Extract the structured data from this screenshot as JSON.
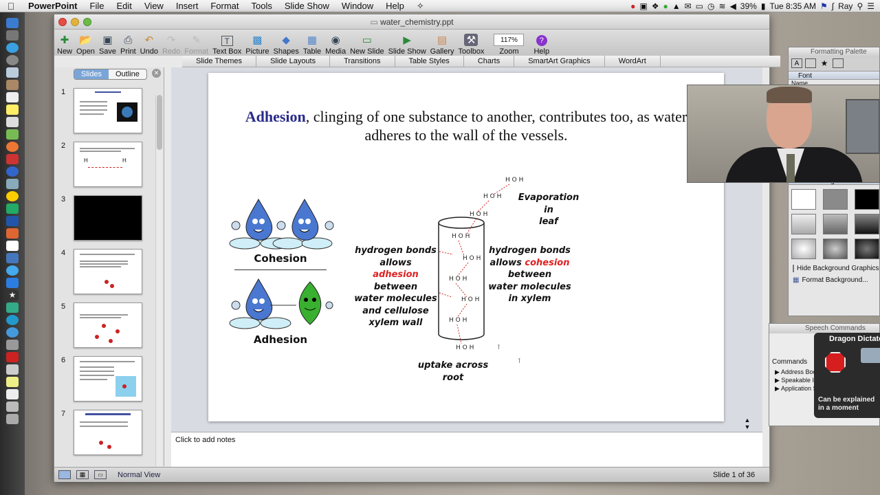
{
  "menubar": {
    "app": "PowerPoint",
    "items": [
      "File",
      "Edit",
      "View",
      "Insert",
      "Format",
      "Tools",
      "Slide Show",
      "Window",
      "Help"
    ],
    "battery": "39%",
    "clock": "Tue 8:35 AM",
    "user": "Ray"
  },
  "window": {
    "title": "water_chemistry.ppt"
  },
  "toolbar": {
    "items": [
      "New",
      "Open",
      "Save",
      "Print",
      "Undo",
      "Redo",
      "Format",
      "Text Box",
      "Picture",
      "Shapes",
      "Table",
      "Media",
      "New Slide",
      "Slide Show",
      "Gallery",
      "Toolbox",
      "Zoom",
      "Help"
    ],
    "zoom": "117%"
  },
  "ribbon": {
    "tabs": [
      "Slide Themes",
      "Slide Layouts",
      "Transitions",
      "Table Styles",
      "Charts",
      "SmartArt Graphics",
      "WordArt"
    ]
  },
  "left_pane": {
    "tabs": [
      "Slides",
      "Outline"
    ],
    "thumbnails": [
      "1",
      "2",
      "3",
      "4",
      "5",
      "6",
      "7"
    ]
  },
  "slide": {
    "title_keyword": "Adhesion",
    "title_rest": ", clinging of one substance to another, contributes too, as water adheres to the wall of the vessels.",
    "cohesion_label": "Cohesion",
    "adhesion_label": "Adhesion",
    "left_text": {
      "l1": "hydrogen bonds",
      "l2": "allows",
      "l3": "adhesion",
      "l4": "between",
      "l5": "water molecules",
      "l6": "and cellulose",
      "l7": "xylem wall"
    },
    "right_text": {
      "l1": "hydrogen bonds",
      "l2a": "allows ",
      "l2b": "cohesion",
      "l3": "between",
      "l4": "water molecules",
      "l5": "in xylem"
    },
    "evaporation": {
      "l1": "Evaporation",
      "l2": "in",
      "l3": "leaf"
    },
    "uptake": {
      "l1": "uptake across",
      "l2": "root"
    }
  },
  "notes": {
    "placeholder": "Click to add notes"
  },
  "status": {
    "view": "Normal View",
    "slide_counter": "Slide 1 of 36"
  },
  "palette": {
    "title": "Formatting Palette",
    "font_section": "Font",
    "name_label": "Name",
    "background_section": "Slide Background",
    "hide_bg": "Hide Background Graphics",
    "format_bg": "Format Background..."
  },
  "speech": {
    "title": "Speech Commands",
    "commands_label": "Commands",
    "items": [
      "Address Book",
      "Speakable Items",
      "Application Switching"
    ]
  },
  "dragon": {
    "title": "Dragon Dictate",
    "message": "Can be explained in a moment"
  },
  "colors": {
    "accent_blue": "#2a2a8a",
    "highlight_red": "#dd2222",
    "segment_selected": "#7aa5d8"
  }
}
